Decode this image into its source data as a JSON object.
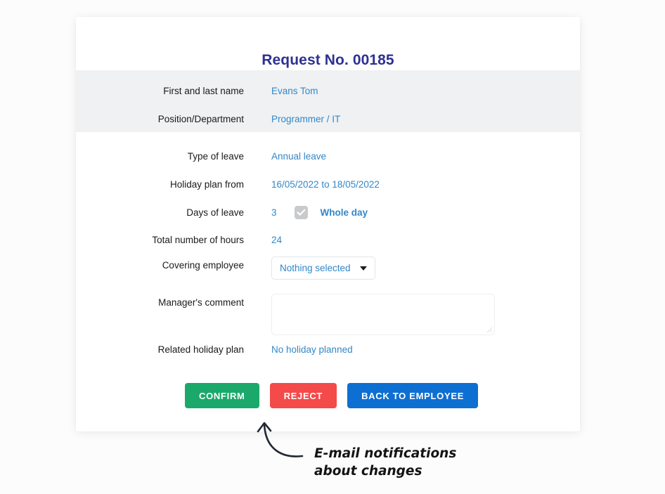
{
  "card": {
    "title": "Request No. 00185",
    "employee_section": [
      {
        "label": "First and last name",
        "value": "Evans Tom"
      },
      {
        "label": "Position/Department",
        "value": "Programmer / IT"
      }
    ],
    "details": {
      "type_of_leave": {
        "label": "Type of leave",
        "value": "Annual leave"
      },
      "holiday_plan": {
        "label": "Holiday plan from",
        "value": "16/05/2022 to 18/05/2022"
      },
      "days_of_leave": {
        "label": "Days of leave",
        "count": "3",
        "checkbox_checked": true,
        "checkbox_label": "Whole day"
      },
      "total_hours": {
        "label": "Total number of hours",
        "value": "24"
      },
      "covering_employee": {
        "label": "Covering employee",
        "selected": "Nothing selected"
      },
      "managers_comment": {
        "label": "Manager's comment",
        "value": "",
        "placeholder": ""
      },
      "related_holiday_plan": {
        "label": "Related holiday plan",
        "value": "No holiday planned"
      }
    },
    "buttons": {
      "confirm": "CONFIRM",
      "reject": "REJECT",
      "back": "BACK TO EMPLOYEE"
    }
  },
  "annotation": {
    "text": "E-mail notifications\nabout changes"
  },
  "colors": {
    "title": "#2e3192",
    "value_blue": "#3287c8",
    "band_gray": "#eff1f3",
    "confirm_green": "#1aa96a",
    "reject_red": "#f44a4a",
    "back_blue": "#0d6fd1",
    "page_bg": "#fcfcfc"
  }
}
